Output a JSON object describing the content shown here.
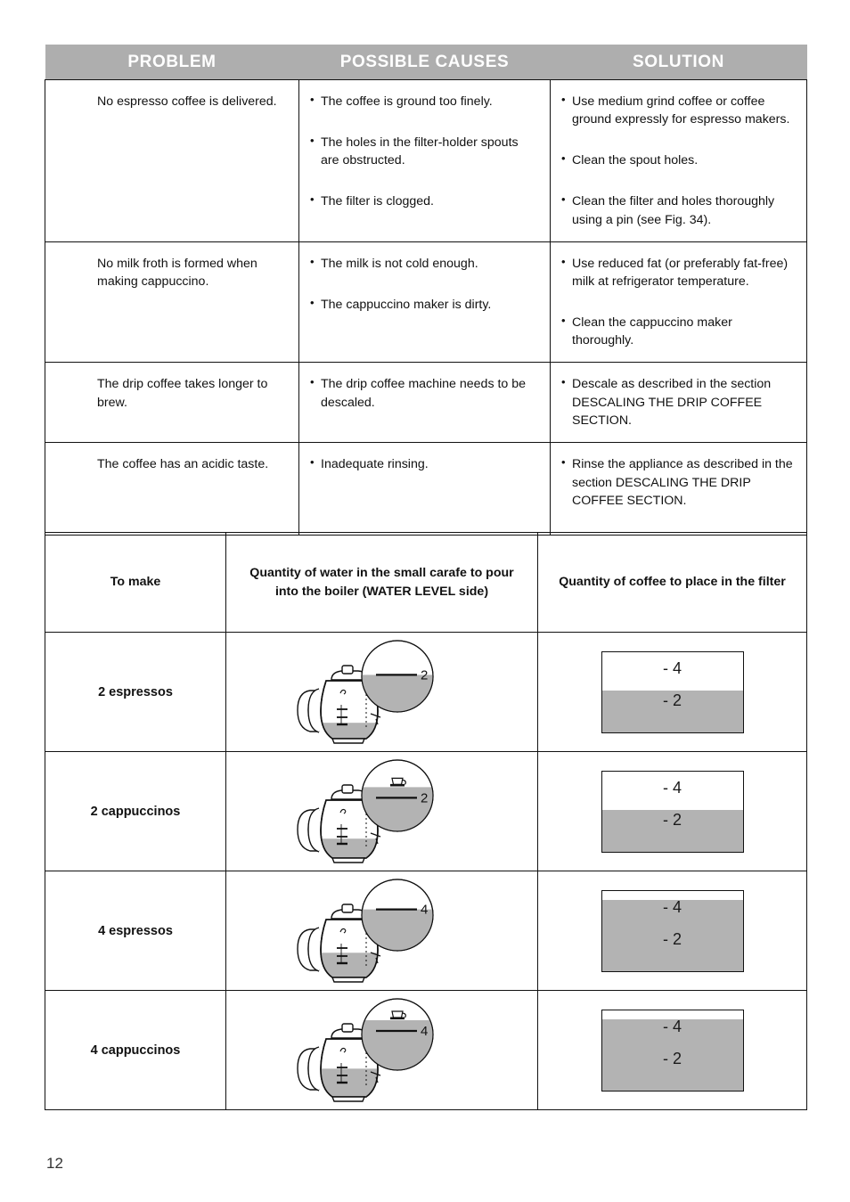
{
  "colors": {
    "header_band": "#aeaeae",
    "fill_gray": "#b3b3b3",
    "rule": "#111111",
    "header_text": "#ffffff"
  },
  "trouble_table": {
    "headers": [
      "PROBLEM",
      "POSSIBLE CAUSES",
      "SOLUTION"
    ],
    "rows": [
      {
        "problem": "No espresso coffee is delivered.",
        "causes": [
          "The coffee is ground too finely.",
          "The holes in the filter-holder spouts are obstructed.",
          "The filter is clogged."
        ],
        "solutions": [
          "Use medium grind coffee or coffee ground expressly for espresso makers.",
          "Clean the spout holes.",
          "Clean the filter and holes thoroughly using a pin (see Fig. 34)."
        ]
      },
      {
        "problem": "No milk froth is formed when making cappuccino.",
        "causes": [
          "The milk is not cold enough.",
          "The cappuccino maker is dirty."
        ],
        "solutions": [
          "Use reduced fat (or preferably fat-free) milk at refrigerator temperature.",
          "Clean the cappuccino maker thoroughly."
        ]
      },
      {
        "problem": "The drip coffee takes longer to brew.",
        "causes": [
          "The drip coffee machine needs to be descaled."
        ],
        "solutions": [
          "Descale as described in the section DESCALING THE DRIP COFFEE SECTION."
        ]
      },
      {
        "problem": "The coffee has an acidic taste.",
        "causes": [
          "Inadequate rinsing."
        ],
        "solutions": [
          "Rinse the appliance as described in the section DESCALING THE DRIP COFFEE SECTION."
        ]
      }
    ]
  },
  "quantity_table": {
    "headers": [
      "To make",
      "Quantity of water in the small carafe to pour into the boiler (WATER LEVEL side)",
      "Quantity of coffee to place in the filter"
    ],
    "rows": [
      {
        "make": "2 espressos",
        "carafe": {
          "level_label": "2",
          "level_value": 2,
          "has_cappuccino_icon": false,
          "callout_fill_pct": 52,
          "carafe_fill_pct": 27
        },
        "filter": {
          "mark_top": "- 4",
          "mark_bottom": "- 2",
          "fill_pct": 52
        }
      },
      {
        "make": "2 cappuccinos",
        "carafe": {
          "level_label": "2",
          "level_value": 2,
          "has_cappuccino_icon": true,
          "callout_fill_pct": 62,
          "carafe_fill_pct": 33
        },
        "filter": {
          "mark_top": "- 4",
          "mark_bottom": "- 2",
          "fill_pct": 52
        }
      },
      {
        "make": "4 espressos",
        "carafe": {
          "level_label": "4",
          "level_value": 4,
          "has_cappuccino_icon": false,
          "callout_fill_pct": 58,
          "carafe_fill_pct": 42
        },
        "filter": {
          "mark_top": "- 4",
          "mark_bottom": "- 2",
          "fill_pct": 88
        }
      },
      {
        "make": "4 cappuccinos",
        "carafe": {
          "level_label": "4",
          "level_value": 4,
          "has_cappuccino_icon": true,
          "callout_fill_pct": 70,
          "carafe_fill_pct": 48
        },
        "filter": {
          "mark_top": "- 4",
          "mark_bottom": "- 2",
          "fill_pct": 88
        }
      }
    ]
  },
  "footer": {
    "page_number": "12"
  }
}
